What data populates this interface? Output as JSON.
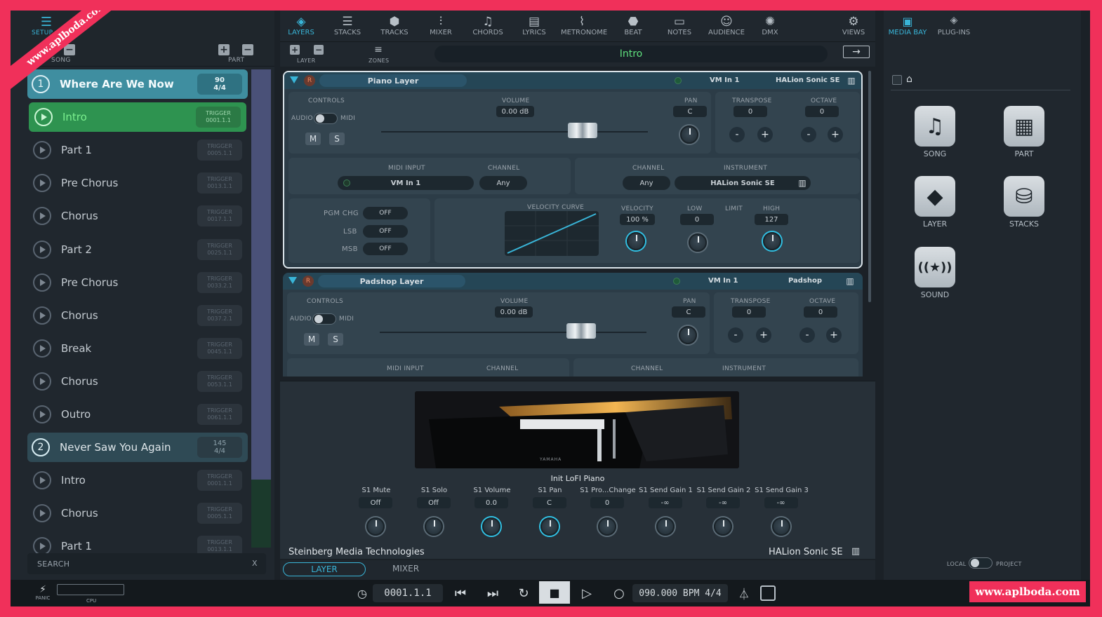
{
  "watermark": {
    "top": "www.aplboda.com",
    "bottom": "www.aplboda.com"
  },
  "left": {
    "setup": "SETUP",
    "song": "SONG",
    "part": "PART",
    "songs": [
      {
        "num": "1",
        "name": "Where Are We Now",
        "tempo": "90",
        "sig": "4/4",
        "parts": [
          {
            "name": "Intro",
            "trigger": "0001.1.1",
            "active": true
          },
          {
            "name": "Part 1",
            "trigger": "0005.1.1"
          },
          {
            "name": "Pre Chorus",
            "trigger": "0013.1.1"
          },
          {
            "name": "Chorus",
            "trigger": "0017.1.1"
          },
          {
            "name": "Part 2",
            "trigger": "0025.1.1"
          },
          {
            "name": "Pre Chorus",
            "trigger": "0033.2.1"
          },
          {
            "name": "Chorus",
            "trigger": "0037.2.1"
          },
          {
            "name": "Break",
            "trigger": "0045.1.1"
          },
          {
            "name": "Chorus",
            "trigger": "0053.1.1"
          },
          {
            "name": "Outro",
            "trigger": "0061.1.1"
          }
        ]
      },
      {
        "num": "2",
        "name": "Never Saw You Again",
        "tempo": "145",
        "sig": "4/4",
        "parts": [
          {
            "name": "Intro",
            "trigger": "0001.1.1"
          },
          {
            "name": "Chorus",
            "trigger": "0005.1.1"
          },
          {
            "name": "Part 1",
            "trigger": "0013.1.1"
          }
        ]
      }
    ],
    "trigger_label": "TRIGGER",
    "search": "SEARCH",
    "search_clear": "X"
  },
  "toolbar": [
    "LAYERS",
    "STACKS",
    "TRACKS",
    "MIXER",
    "CHORDS",
    "LYRICS",
    "METRONOME",
    "BEAT",
    "NOTES",
    "AUDIENCE",
    "DMX",
    "VIEWS"
  ],
  "subbar": {
    "layer": "LAYER",
    "zones": "ZONES",
    "part_name": "Intro"
  },
  "labels": {
    "controls": "CONTROLS",
    "audio": "AUDIO",
    "midi": "MIDI",
    "volume": "VOLUME",
    "pan": "PAN",
    "transpose": "TRANSPOSE",
    "octave": "OCTAVE",
    "midi_input": "MIDI INPUT",
    "channel": "CHANNEL",
    "instrument": "INSTRUMENT",
    "pgm": "PGM CHG",
    "lsb": "LSB",
    "msb": "MSB",
    "vel_curve": "VELOCITY CURVE",
    "velocity": "VELOCITY",
    "low": "LOW",
    "limit": "LIMIT",
    "high": "HIGH",
    "m": "M",
    "s": "S",
    "r": "R",
    "minus": "-",
    "plus": "+"
  },
  "layers": [
    {
      "name": "Piano Layer",
      "input": "VM In 1",
      "plugin": "HALion Sonic SE",
      "volume": "0.00 dB",
      "pan": "C",
      "transpose": "0",
      "octave": "0",
      "midi_input": "VM In 1",
      "channel_in": "Any",
      "channel_out": "Any",
      "instrument": "HALion Sonic SE",
      "pgm": "OFF",
      "lsb": "OFF",
      "msb": "OFF",
      "velocity": "100 %",
      "low": "0",
      "high": "127"
    },
    {
      "name": "Padshop Layer",
      "input": "VM In 1",
      "plugin": "Padshop",
      "volume": "0.00 dB",
      "pan": "C",
      "transpose": "0",
      "octave": "0"
    }
  ],
  "plugin": {
    "preset": "Init LoFI Piano",
    "brand": "YAMAHA",
    "vendor": "Steinberg Media Technologies",
    "product": "HALion Sonic SE",
    "params": [
      {
        "label": "S1 Mute",
        "value": "Off"
      },
      {
        "label": "S1 Solo",
        "value": "Off"
      },
      {
        "label": "S1 Volume",
        "value": "0.0"
      },
      {
        "label": "S1 Pan",
        "value": "C"
      },
      {
        "label": "S1 Pro...Change",
        "value": "0"
      },
      {
        "label": "S1 Send Gain 1",
        "value": "-∞"
      },
      {
        "label": "S1 Send Gain 2",
        "value": "-∞"
      },
      {
        "label": "S1 Send Gain 3",
        "value": "-∞"
      }
    ]
  },
  "center_tabs": {
    "layer": "LAYER",
    "mixer": "MIXER"
  },
  "right": {
    "media_bay": "MEDIA BAY",
    "plugins": "PLUG-INS",
    "items": [
      "SONG",
      "PART",
      "LAYER",
      "STACKS",
      "SOUND"
    ],
    "local": "LOCAL",
    "project": "PROJECT"
  },
  "transport": {
    "panic": "PANIC",
    "cpu": "CPU",
    "position": "0001.1.1",
    "bpm": "090.000 BPM",
    "sig": "4/4"
  }
}
